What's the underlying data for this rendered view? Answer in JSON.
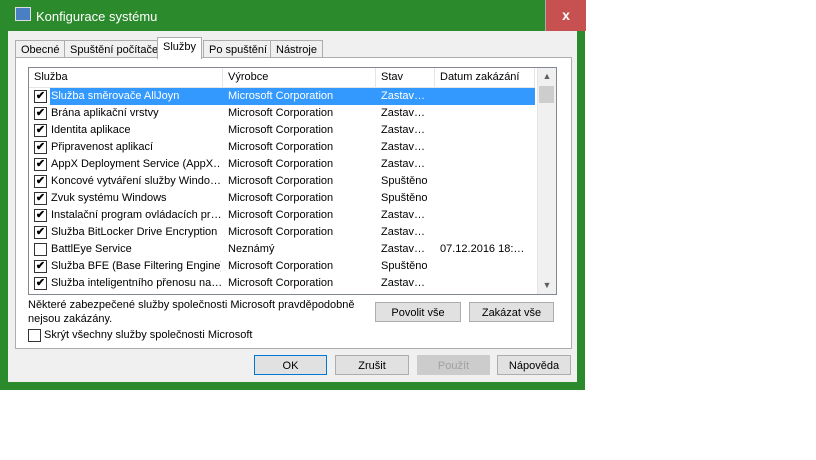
{
  "window": {
    "title": "Konfigurace systému",
    "close": "x"
  },
  "tabs": [
    "Obecné",
    "Spuštění počítače",
    "Služby",
    "Po spuštění",
    "Nástroje"
  ],
  "columns": [
    "Služba",
    "Výrobce",
    "Stav",
    "Datum zakázání"
  ],
  "rows": [
    {
      "checked": true,
      "name": "Služba směrovače AllJoyn",
      "vendor": "Microsoft Corporation",
      "status": "Zastav…",
      "date": "",
      "selected": true
    },
    {
      "checked": true,
      "name": "Brána aplikační vrstvy",
      "vendor": "Microsoft Corporation",
      "status": "Zastav…",
      "date": ""
    },
    {
      "checked": true,
      "name": "Identita aplikace",
      "vendor": "Microsoft Corporation",
      "status": "Zastav…",
      "date": ""
    },
    {
      "checked": true,
      "name": "Připravenost aplikací",
      "vendor": "Microsoft Corporation",
      "status": "Zastav…",
      "date": ""
    },
    {
      "checked": true,
      "name": "AppX Deployment Service (AppX…",
      "vendor": "Microsoft Corporation",
      "status": "Zastav…",
      "date": ""
    },
    {
      "checked": true,
      "name": "Koncové vytváření služby Windo…",
      "vendor": "Microsoft Corporation",
      "status": "Spuštěno",
      "date": ""
    },
    {
      "checked": true,
      "name": "Zvuk systému Windows",
      "vendor": "Microsoft Corporation",
      "status": "Spuštěno",
      "date": ""
    },
    {
      "checked": true,
      "name": "Instalační program ovládacích pr…",
      "vendor": "Microsoft Corporation",
      "status": "Zastav…",
      "date": ""
    },
    {
      "checked": true,
      "name": "Služba BitLocker Drive Encryption",
      "vendor": "Microsoft Corporation",
      "status": "Zastav…",
      "date": ""
    },
    {
      "checked": false,
      "name": "BattlEye Service",
      "vendor": "Neznámý",
      "status": "Zastav…",
      "date": "07.12.2016 18:…"
    },
    {
      "checked": true,
      "name": "Služba BFE (Base Filtering Engine)",
      "vendor": "Microsoft Corporation",
      "status": "Spuštěno",
      "date": ""
    },
    {
      "checked": true,
      "name": "Služba inteligentního přenosu na…",
      "vendor": "Microsoft Corporation",
      "status": "Zastav…",
      "date": ""
    }
  ],
  "note": [
    "Některé zabezpečené služby společnosti Microsoft pravděpodobně",
    "nejsou zakázány."
  ],
  "enable_all": "Povolit vše",
  "disable_all": "Zakázat vše",
  "hide_ms": "Skrýt všechny služby společnosti Microsoft",
  "buttons": {
    "ok": "OK",
    "cancel": "Zrušit",
    "apply": "Použít",
    "help": "Nápověda"
  },
  "check_mark": "✔"
}
